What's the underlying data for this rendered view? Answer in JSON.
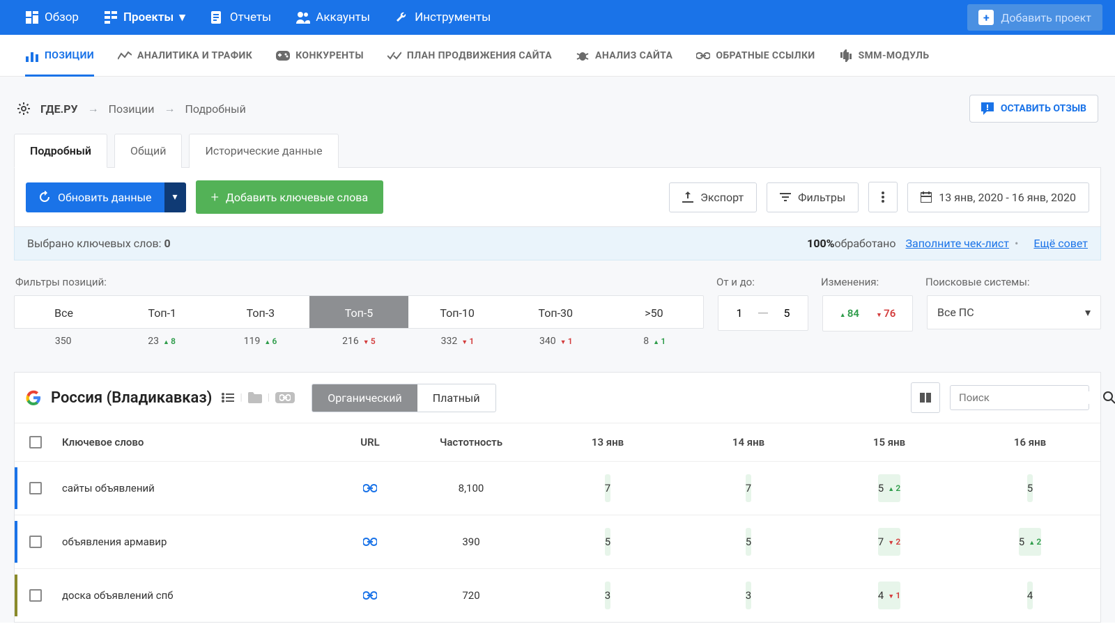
{
  "topnav": {
    "overview": "Обзор",
    "projects": "Проекты",
    "reports": "Отчеты",
    "accounts": "Аккаунты",
    "tools": "Инструменты",
    "add_project": "Добавить проект"
  },
  "secnav": {
    "positions": "ПОЗИЦИИ",
    "analytics": "АНАЛИТИКА И ТРАФИК",
    "competitors": "КОНКУРЕНТЫ",
    "promotion": "ПЛАН ПРОДВИЖЕНИЯ САЙТА",
    "analysis": "АНАЛИЗ САЙТА",
    "backlinks": "ОБРАТНЫЕ ССЫЛКИ",
    "smm": "SMM-МОДУЛЬ"
  },
  "breadcrumb": {
    "site": "ГДЕ.РУ",
    "level1": "Позиции",
    "level2": "Подробный"
  },
  "feedback_btn": "ОСТАВИТЬ ОТЗЫВ",
  "subtabs": {
    "detailed": "Подробный",
    "general": "Общий",
    "historical": "Исторические данные"
  },
  "toolbar": {
    "refresh": "Обновить данные",
    "add_keywords": "Добавить ключевые слова",
    "export": "Экспорт",
    "filters": "Фильтры",
    "date_range": "13 янв, 2020 - 16 янв, 2020"
  },
  "infobar": {
    "selected_label": "Выбрано ключевых слов: ",
    "selected_count": "0",
    "pct": "100%",
    "processed": "обработано",
    "link_checklist": "Заполните чек-лист",
    "link_more": "Ещё совет"
  },
  "filters": {
    "label_positions": "Фильтры позиций:",
    "label_range": "От и до:",
    "label_changes": "Изменения:",
    "label_ps": "Поисковые системы:",
    "range_from": "1",
    "range_to": "5",
    "changes_up": "84",
    "changes_dn": "76",
    "ps_value": "Все ПС",
    "items": [
      {
        "label": "Все",
        "count": "350",
        "delta": "",
        "dir": ""
      },
      {
        "label": "Топ-1",
        "count": "23",
        "delta": "8",
        "dir": "up"
      },
      {
        "label": "Топ-3",
        "count": "119",
        "delta": "6",
        "dir": "up"
      },
      {
        "label": "Топ-5",
        "count": "216",
        "delta": "5",
        "dir": "dn"
      },
      {
        "label": "Топ-10",
        "count": "332",
        "delta": "1",
        "dir": "dn"
      },
      {
        "label": "Топ-30",
        "count": "340",
        "delta": "1",
        "dir": "dn"
      },
      {
        "label": ">50",
        "count": "8",
        "delta": "1",
        "dir": "up"
      }
    ],
    "active_index": 3
  },
  "region": {
    "title": "Россия (Владикавказ)",
    "tab_organic": "Органический",
    "tab_paid": "Платный",
    "search_placeholder": "Поиск"
  },
  "table": {
    "headers": {
      "keyword": "Ключевое слово",
      "url": "URL",
      "frequency": "Частотность",
      "dates": [
        "13 янв",
        "14 янв",
        "15 янв",
        "16 янв"
      ]
    },
    "rows": [
      {
        "accent": "#1a73e8",
        "keyword": "сайты объявлений",
        "freq": "8,100",
        "cells": [
          {
            "val": "7",
            "delta": "",
            "dir": "",
            "green": true
          },
          {
            "val": "7",
            "delta": "",
            "dir": "",
            "green": true
          },
          {
            "val": "5",
            "delta": "2",
            "dir": "up",
            "green": true
          },
          {
            "val": "5",
            "delta": "",
            "dir": "",
            "green": true
          }
        ]
      },
      {
        "accent": "#1a73e8",
        "keyword": "объявления армавир",
        "freq": "390",
        "cells": [
          {
            "val": "5",
            "delta": "",
            "dir": "",
            "green": true
          },
          {
            "val": "5",
            "delta": "",
            "dir": "",
            "green": true
          },
          {
            "val": "7",
            "delta": "2",
            "dir": "dn",
            "green": true
          },
          {
            "val": "5",
            "delta": "2",
            "dir": "up",
            "green": true
          }
        ]
      },
      {
        "accent": "#8a8a2a",
        "keyword": "доска объявлений спб",
        "freq": "720",
        "cells": [
          {
            "val": "3",
            "delta": "",
            "dir": "",
            "green": true
          },
          {
            "val": "3",
            "delta": "",
            "dir": "",
            "green": true
          },
          {
            "val": "4",
            "delta": "1",
            "dir": "dn",
            "green": true
          },
          {
            "val": "4",
            "delta": "",
            "dir": "",
            "green": true
          }
        ]
      }
    ]
  }
}
